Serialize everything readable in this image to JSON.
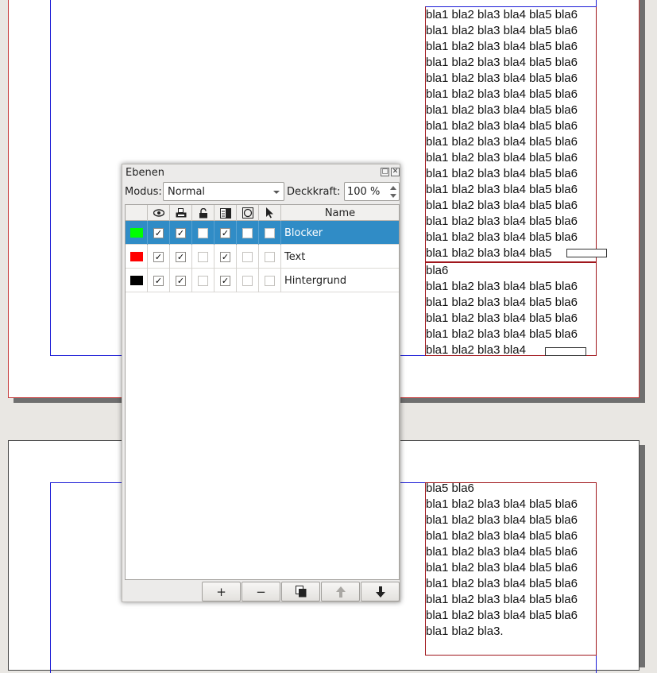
{
  "document": {
    "text_line": "bla1 bla2 bla3 bla4 bla5 bla6",
    "page1_frame_a_last": "bla1 bla2 bla3 bla4 bla5",
    "page1_frame_b_first": "bla6",
    "page1_frame_b_last": "bla1 bla2 bla3 bla4",
    "page2_first": "bla5 bla6",
    "page2_last": "bla1 bla2 bla3."
  },
  "palette": {
    "title": "Ebenen",
    "float_icon": "float-icon",
    "close_icon": "close-icon",
    "mode_label": "Modus:",
    "mode_value": "Normal",
    "opacity_label": "Deckkraft:",
    "opacity_value": "100 %",
    "columns": {
      "color": "",
      "visible": "eye-icon",
      "print": "printer-icon",
      "lock": "lock-icon",
      "flow": "text-flow-icon",
      "outline": "outline-icon",
      "select": "cursor-arrow-icon",
      "name": "Name"
    },
    "layers": [
      {
        "color": "#00ff00",
        "visible": true,
        "print": true,
        "lock": false,
        "flow": true,
        "outline": false,
        "select": false,
        "name": "Blocker",
        "selected": true
      },
      {
        "color": "#ff0000",
        "visible": true,
        "print": true,
        "lock": false,
        "flow": true,
        "outline": false,
        "select": false,
        "name": "Text",
        "selected": false
      },
      {
        "color": "#000000",
        "visible": true,
        "print": true,
        "lock": false,
        "flow": true,
        "outline": false,
        "select": false,
        "name": "Hintergrund",
        "selected": false
      }
    ],
    "buttons": {
      "add": "+",
      "remove": "−",
      "duplicate": "duplicate-icon",
      "raise": "arrow-up-icon",
      "lower": "arrow-down-icon"
    }
  }
}
